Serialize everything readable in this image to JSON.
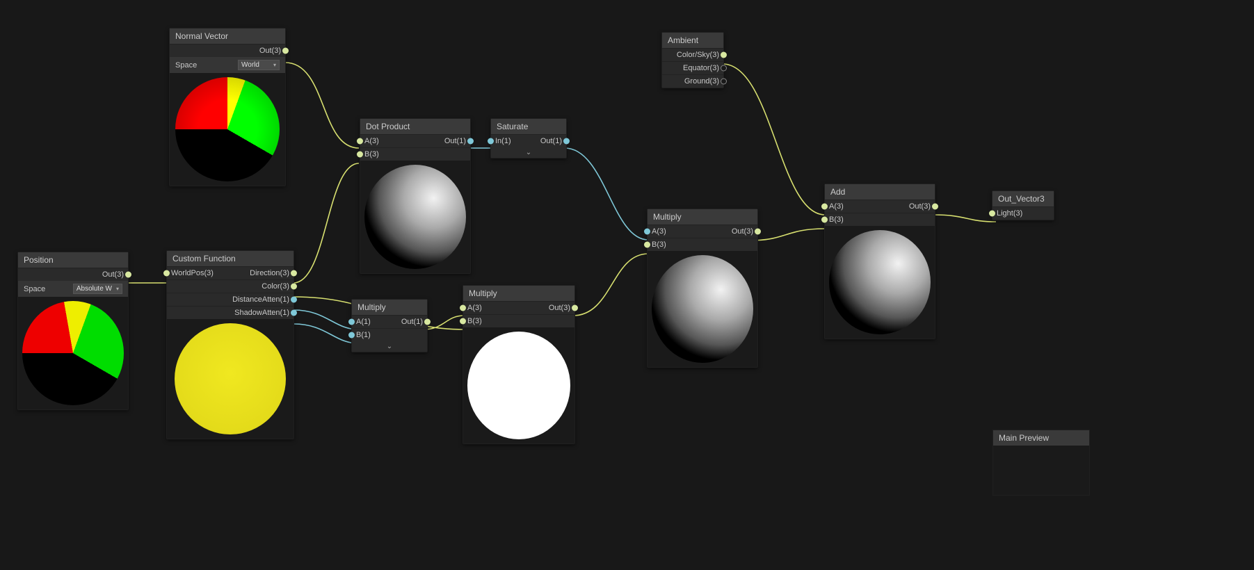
{
  "nodes": {
    "normalVector": {
      "title": "Normal Vector",
      "out": "Out(3)",
      "spaceLabel": "Space",
      "spaceValue": "World"
    },
    "position": {
      "title": "Position",
      "out": "Out(3)",
      "spaceLabel": "Space",
      "spaceValue": "Absolute W"
    },
    "customFunction": {
      "title": "Custom Function",
      "inWorldPos": "WorldPos(3)",
      "outDirection": "Direction(3)",
      "outColor": "Color(3)",
      "outDistanceAtten": "DistanceAtten(1)",
      "outShadowAtten": "ShadowAtten(1)"
    },
    "dotProduct": {
      "title": "Dot Product",
      "a": "A(3)",
      "b": "B(3)",
      "out": "Out(1)"
    },
    "multiply1": {
      "title": "Multiply",
      "a": "A(1)",
      "b": "B(1)",
      "out": "Out(1)"
    },
    "saturate": {
      "title": "Saturate",
      "in": "In(1)",
      "out": "Out(1)"
    },
    "multiply2": {
      "title": "Multiply",
      "a": "A(3)",
      "b": "B(3)",
      "out": "Out(3)"
    },
    "multiply3": {
      "title": "Multiply",
      "a": "A(3)",
      "b": "B(3)",
      "out": "Out(3)"
    },
    "ambient": {
      "title": "Ambient",
      "colorSky": "Color/Sky(3)",
      "equator": "Equator(3)",
      "ground": "Ground(3)"
    },
    "add": {
      "title": "Add",
      "a": "A(3)",
      "b": "B(3)",
      "out": "Out(3)"
    },
    "outVector3": {
      "title": "Out_Vector3",
      "light": "Light(3)"
    }
  },
  "mainPreview": "Main Preview"
}
